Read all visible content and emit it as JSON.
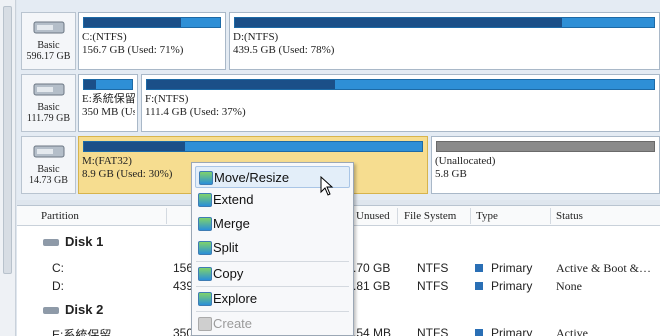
{
  "disks": [
    {
      "type": "Basic",
      "capacity": "596.17 GB",
      "partitions": [
        {
          "label": "C:(NTFS)",
          "size": "156.7 GB (Used: 71%)",
          "used_fraction": 0.71
        },
        {
          "label": "D:(NTFS)",
          "size": "439.5 GB (Used: 78%)",
          "used_fraction": 0.78
        }
      ]
    },
    {
      "type": "Basic",
      "capacity": "111.79 GB",
      "partitions": [
        {
          "label": "E:系統保留",
          "size": "350 MB (Us",
          "used_fraction": 0.25
        },
        {
          "label": "F:(NTFS)",
          "size": "111.4 GB (Used: 37%)",
          "used_fraction": 0.37
        }
      ]
    },
    {
      "type": "Basic",
      "capacity": "14.73 GB",
      "partitions": [
        {
          "label": "M:(FAT32)",
          "size": "8.9 GB (Used: 30%)",
          "used_fraction": 0.3
        },
        {
          "label": "(Unallocated)",
          "size": "5.8 GB",
          "used_fraction": 0
        }
      ]
    }
  ],
  "columns": {
    "partition": "Partition",
    "unused": "Unused",
    "file_system": "File System",
    "type": "Type",
    "status": "Status"
  },
  "groups": [
    {
      "name": "Disk 1",
      "rows": [
        {
          "partition": "C:",
          "capacity": "156",
          "unused": ".70 GB",
          "fs": "NTFS",
          "type": "Primary",
          "status": "Active & Boot &…"
        },
        {
          "partition": "D:",
          "capacity": "439",
          "unused": ".81 GB",
          "fs": "NTFS",
          "type": "Primary",
          "status": "None"
        }
      ]
    },
    {
      "name": "Disk 2",
      "rows": [
        {
          "partition": "E:系統保留",
          "capacity": "350",
          "unused": ".54 MB",
          "fs": "NTFS",
          "type": "Primary",
          "status": "Active"
        }
      ]
    }
  ],
  "context_menu": [
    "Move/Resize",
    "Extend",
    "Merge",
    "Split",
    "Copy",
    "Explore",
    "Create"
  ],
  "colors": {
    "bar": "#2e8fd6",
    "used": "#1b4f88",
    "selected": "#f6dd90",
    "primary_square": "#2a6fb5"
  }
}
